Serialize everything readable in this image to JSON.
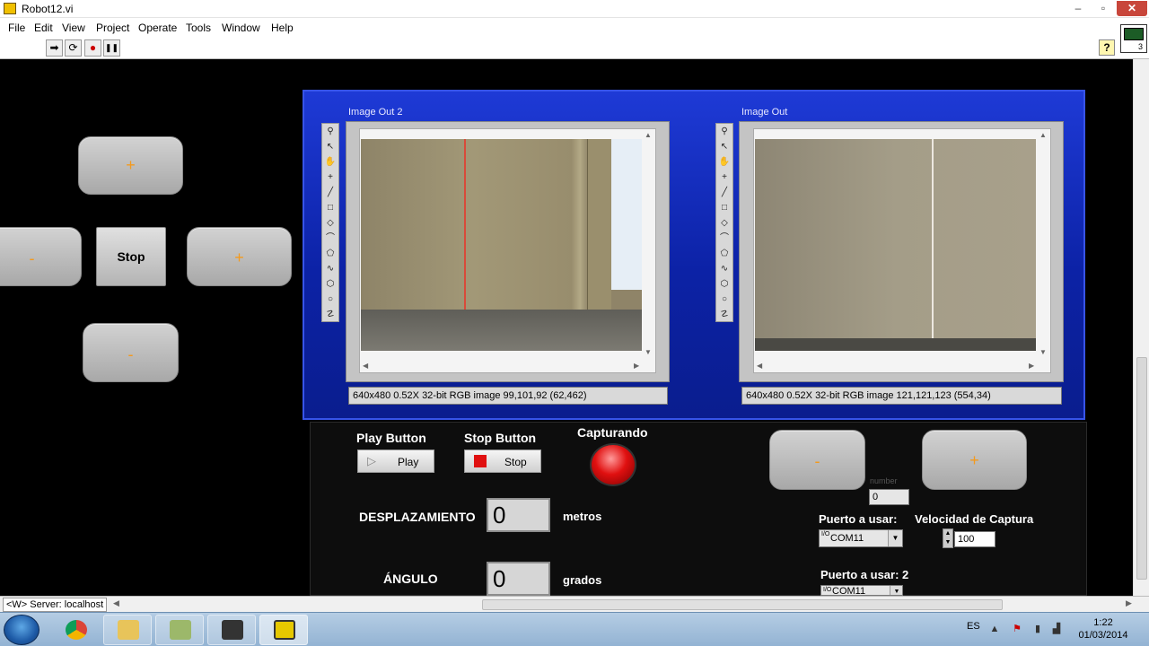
{
  "window": {
    "title": "Robot12.vi",
    "min_glyph": "–",
    "max_glyph": "▫",
    "close_glyph": "✕"
  },
  "menu": [
    {
      "label": "File"
    },
    {
      "label": "Edit"
    },
    {
      "label": "View"
    },
    {
      "label": "Project"
    },
    {
      "label": "Operate"
    },
    {
      "label": "Tools"
    },
    {
      "label": "Window"
    },
    {
      "label": "Help"
    }
  ],
  "toolbar": {
    "buttons": [
      {
        "name": "run-arrow-icon",
        "glyph": "➡"
      },
      {
        "name": "run-continuously-icon",
        "glyph": "⟳"
      },
      {
        "name": "abort-icon",
        "glyph": "●"
      },
      {
        "name": "pause-icon",
        "glyph": "❚❚"
      }
    ],
    "help_glyph": "?",
    "vi_icon_number": "3"
  },
  "left_pad": {
    "up_label": "+",
    "left_label": "-",
    "stop_label": "Stop",
    "right_label": "+",
    "down_label": "-"
  },
  "image_displays": [
    {
      "label": "Image Out 2",
      "status": "640x480 0.52X 32-bit RGB image 99,101,92     (62,462)"
    },
    {
      "label": "Image Out",
      "status": "640x480 0.52X 32-bit RGB image 121,121,123     (554,34)"
    }
  ],
  "image_tools": [
    {
      "name": "zoom-icon",
      "glyph": "⚲"
    },
    {
      "name": "pointer-icon",
      "glyph": "↖"
    },
    {
      "name": "pan-hand-icon",
      "glyph": "✋"
    },
    {
      "name": "point-tool-icon",
      "glyph": "+"
    },
    {
      "name": "line-tool-icon",
      "glyph": "╱"
    },
    {
      "name": "rectangle-tool-icon",
      "glyph": "□"
    },
    {
      "name": "rotated-rect-tool-icon",
      "glyph": "◇"
    },
    {
      "name": "annulus-tool-icon",
      "glyph": "⌒"
    },
    {
      "name": "polygon-tool-icon",
      "glyph": "⬠"
    },
    {
      "name": "freehand-line-icon",
      "glyph": "∿"
    },
    {
      "name": "freehand-region-icon",
      "glyph": "⬡"
    },
    {
      "name": "oval-tool-icon",
      "glyph": "○"
    },
    {
      "name": "broken-line-icon",
      "glyph": "☡"
    }
  ],
  "controls": {
    "play_button": {
      "caption": "Play Button",
      "label": "Play",
      "glyph": "▷"
    },
    "stop_button": {
      "caption": "Stop Button",
      "label": "Stop"
    },
    "capturing": {
      "caption": "Capturando",
      "led_color": "#e01010"
    },
    "displacement": {
      "label": "DESPLAZAMIENTO",
      "value": "0",
      "unit": "metros"
    },
    "angle": {
      "label": "ÁNGULO",
      "value": "0",
      "unit": "grados"
    },
    "minus_label": "-",
    "plus_label": "+",
    "number": {
      "label": "number",
      "value": "0"
    },
    "port": {
      "label": "Puerto a usar:",
      "value": "COM11",
      "prefix": "I/O"
    },
    "port2": {
      "label": "Puerto a usar: 2",
      "value": "COM11",
      "prefix": "I/O"
    },
    "speed": {
      "label": "Velocidad de Captura",
      "value": "100"
    }
  },
  "statusbar": {
    "server": "<W> Server: localhost"
  },
  "taskbar": {
    "lang": "ES",
    "time": "1:22",
    "date": "01/03/2014"
  }
}
